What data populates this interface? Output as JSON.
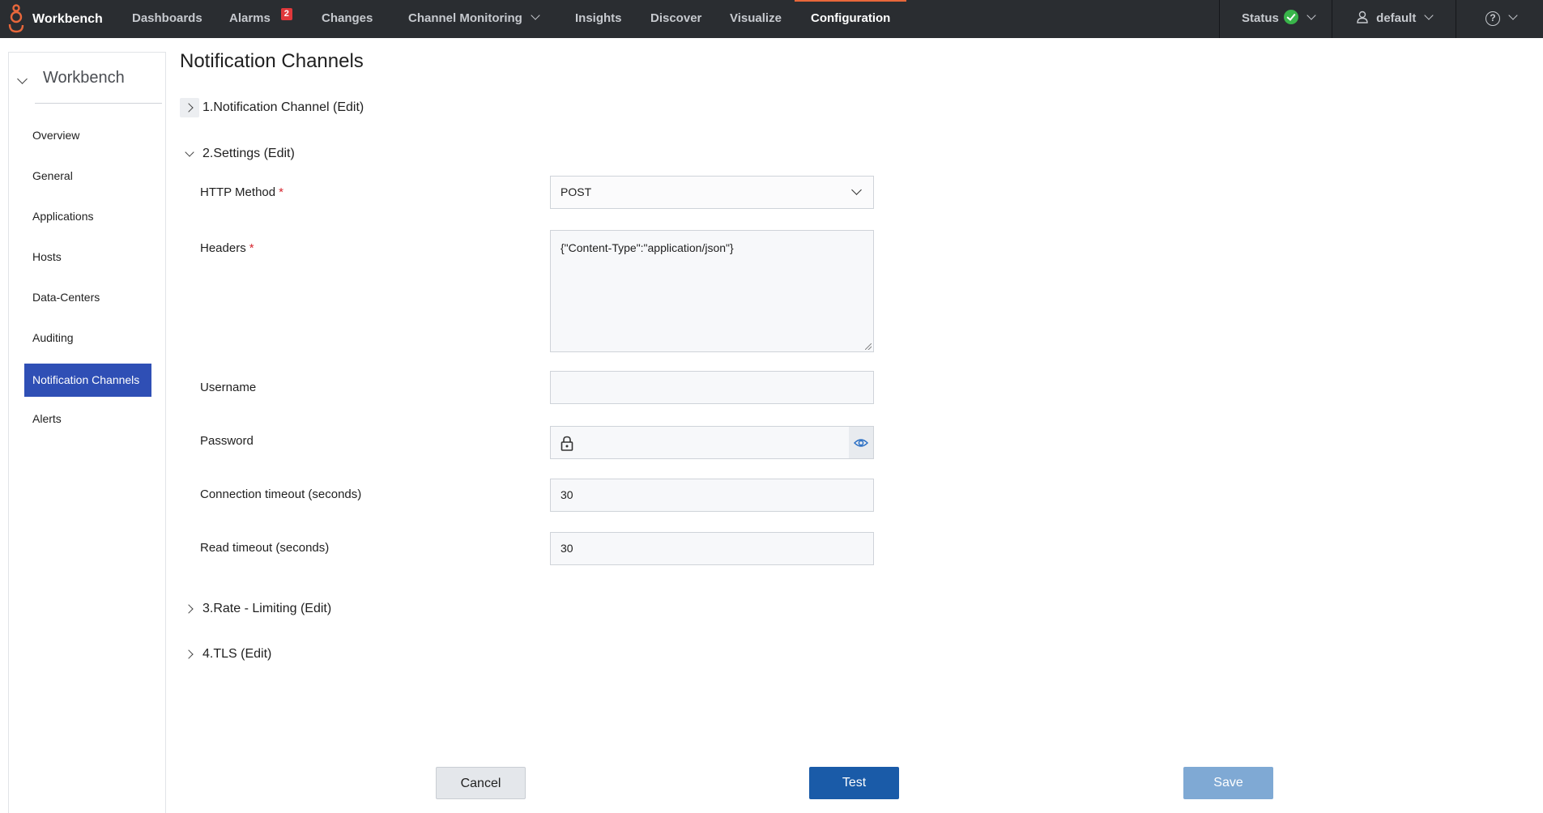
{
  "topnav": {
    "brand": "Workbench",
    "items": [
      {
        "label": "Dashboards"
      },
      {
        "label": "Alarms",
        "badge": "2"
      },
      {
        "label": "Changes"
      },
      {
        "label": "Channel Monitoring"
      },
      {
        "label": "Insights"
      },
      {
        "label": "Discover"
      },
      {
        "label": "Visualize"
      },
      {
        "label": "Configuration",
        "active": true
      }
    ],
    "status_label": "Status",
    "user_label": "default",
    "accent_color": "#e8673b",
    "status_color": "#39b54a"
  },
  "sidebar": {
    "title": "Workbench",
    "items": [
      {
        "label": "Overview"
      },
      {
        "label": "General"
      },
      {
        "label": "Applications"
      },
      {
        "label": "Hosts"
      },
      {
        "label": "Data-Centers"
      },
      {
        "label": "Auditing"
      },
      {
        "label": "Notification Channels",
        "active": true
      },
      {
        "label": "Alerts"
      }
    ],
    "active_color": "#2f4fb5"
  },
  "main": {
    "title": "Notification Channels",
    "sections": [
      {
        "label": "1.Notification Channel (Edit)",
        "expanded": false
      },
      {
        "label": "2.Settings (Edit)",
        "expanded": true
      },
      {
        "label": "3.Rate - Limiting (Edit)",
        "expanded": false
      },
      {
        "label": "4.TLS (Edit)",
        "expanded": false
      }
    ],
    "fields": {
      "http_method": {
        "label": "HTTP Method",
        "required": "*",
        "value": "POST"
      },
      "headers": {
        "label": "Headers",
        "required": "*",
        "value": "{\"Content-Type\":\"application/json\"}"
      },
      "username": {
        "label": "Username",
        "value": ""
      },
      "password": {
        "label": "Password",
        "value": ""
      },
      "connection_timeout": {
        "label": "Connection timeout (seconds)",
        "value": "30"
      },
      "read_timeout": {
        "label": "Read timeout (seconds)",
        "value": "30"
      }
    }
  },
  "actions": {
    "cancel": "Cancel",
    "test": "Test",
    "save": "Save",
    "primary_color": "#1a5ba8",
    "disabled_color": "#7fa9d4"
  }
}
